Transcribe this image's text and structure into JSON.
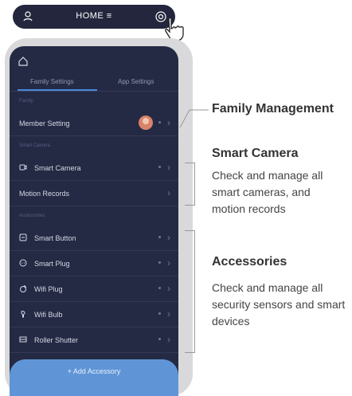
{
  "top_bar": {
    "title": "HOME ≡"
  },
  "tabs": [
    {
      "label": "Family Settings"
    },
    {
      "label": "App Settings"
    }
  ],
  "sections": {
    "family": "Family",
    "smart_camera": "Smart Camera",
    "accessories": "Accessories"
  },
  "family_rows": [
    {
      "label": "Member Setting"
    }
  ],
  "camera_rows": [
    {
      "label": "Smart Camera"
    },
    {
      "label": "Motion Records"
    }
  ],
  "accessory_rows": [
    {
      "label": "Smart Button"
    },
    {
      "label": "Smart Plug"
    },
    {
      "label": "Wifi Plug"
    },
    {
      "label": "Wifi Bulb"
    },
    {
      "label": "Roller Shutter"
    }
  ],
  "add_button": {
    "label": "+ Add Accessory"
  },
  "callouts": {
    "family": {
      "title": "Family Management"
    },
    "camera": {
      "title": "Smart Camera",
      "lines": [
        "Check and manage all",
        "smart cameras, and",
        "motion records"
      ]
    },
    "accessories": {
      "title": "Accessories",
      "lines": [
        "Check and manage all",
        "security sensors and smart",
        "devices"
      ]
    }
  },
  "colors": {
    "screen_bg": "#252a44",
    "accent": "#4b88dc",
    "add_button": "#5f95d6"
  }
}
